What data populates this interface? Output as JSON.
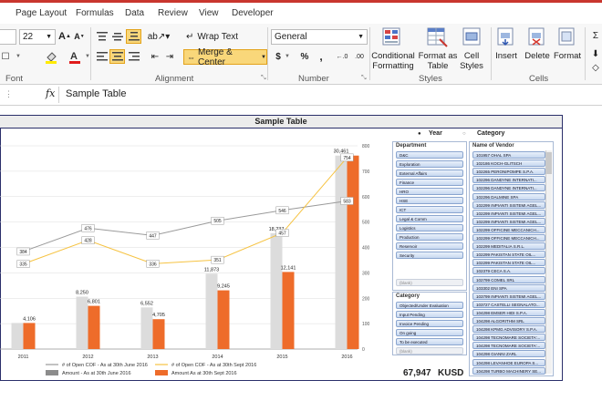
{
  "menu": {
    "items": [
      "Page Layout",
      "Formulas",
      "Data",
      "Review",
      "View",
      "Developer"
    ]
  },
  "ribbon": {
    "font_size": "22",
    "font_group_label": "Font",
    "wrap_text": "Wrap Text",
    "merge_center": "Merge & Center",
    "alignment_label": "Alignment",
    "number_format": "General",
    "number_label": "Number",
    "currency": "$",
    "percent": "%",
    "comma": ",",
    "conditional_formatting": [
      "Conditional",
      "Formatting"
    ],
    "format_as_table": [
      "Format as",
      "Table"
    ],
    "cell_styles": [
      "Cell",
      "Styles"
    ],
    "styles_label": "Styles",
    "insert": "Insert",
    "delete": "Delete",
    "format": "Format",
    "cells_label": "Cells",
    "decimal_inc": "←.0",
    "decimal_dec": ".00"
  },
  "formula": {
    "fx": "fx",
    "value": "Sample Table"
  },
  "dashboard": {
    "title": "Sample Table",
    "radio_year": "Year",
    "radio_category": "Category",
    "total_value": "67,947",
    "total_unit": "KUSD"
  },
  "department_slicer": {
    "header": "Department",
    "items": [
      "D&C",
      "Exploration",
      "External Affairs",
      "Finance",
      "HRO",
      "HSE",
      "ICT",
      "Legal & Comm",
      "Logistics",
      "Production",
      "Reservoir",
      "Security"
    ],
    "dim_items": [
      "(blank)"
    ]
  },
  "category_slicer": {
    "header": "Category",
    "items": [
      "Objected/Under Evaluation",
      "Input Pending",
      "Invoice Pending",
      "On going",
      "To be executed"
    ],
    "dim_items": [
      "(blank)"
    ]
  },
  "vendor_slicer": {
    "header": "Name of Vendor",
    "items": [
      "101957 OHAL SPA",
      "102186 KOCH-GLITSCH",
      "102265 PERONIPOMPE S.P.A.",
      "102296 DANDYNE INTERNATI...",
      "102296 DANDYNE INTERNATI...",
      "102296 DALMINE SPA",
      "102299 INPIANTI SISTEMI AGEL...",
      "102299 INPIANTI SISTEMI AGEL...",
      "102299 INPIANTI SISTEMI AGEL...",
      "102299 OFFICINE MECCANICH...",
      "102299 OFFICINE MECCANICH...",
      "102299 MEDITALIA S.R.L.",
      "102299 PAKISTAN STATE OIL...",
      "102299 PAKISTAN STATE OIL...",
      "102379 CECA S.A.",
      "102799 COMEL SRL",
      "103302 ENI SPA",
      "103799 INPIANTI SISTEMI AGEL...",
      "103727 CASTELLI SEGNALATO...",
      "104298 EMSER HIDI S.P.A.",
      "104298 ALGORITHM SRL",
      "104298 KPMG ADVISORY S.P.A.",
      "104298 TECNOMARE SOCIETA'...",
      "104298 TECNOMARE SOCIETA'...",
      "104298 GIANNI ZARL",
      "104298 LEVANHOE EUROPA S...",
      "104298 TURBO MACHINERY SE..."
    ]
  },
  "chart_data": {
    "type": "bar",
    "categories": [
      "2011",
      "2012",
      "2013",
      "2014",
      "2015",
      "2016"
    ],
    "series": [
      {
        "name": "Amount - As at 30th June 2016",
        "kind": "bar",
        "color": "#8c8c8c",
        "values": [
          4106,
          8250,
          6552,
          11873,
          18237,
          30461
        ]
      },
      {
        "name": "Amount As at 30th Sept 2016",
        "kind": "bar",
        "color": "#ee6c2a",
        "values": [
          4106,
          6801,
          4705,
          9245,
          12141,
          30461
        ]
      },
      {
        "name": "# of Open COF - As at 30th June 2016",
        "kind": "line",
        "color": "#9a9a9a",
        "values": [
          384,
          476,
          447,
          505,
          546,
          583
        ]
      },
      {
        "name": "# of Open COF - As at 30th Sept 2016",
        "kind": "line",
        "color": "#f6c342",
        "values": [
          335,
          428,
          336,
          351,
          457,
          754
        ]
      }
    ],
    "bar_labels": [
      [
        "",
        "8,250",
        "6,552",
        "11,873",
        "18,237",
        "30,461"
      ],
      [
        "4,106",
        "6,801",
        "4,705",
        "9,245",
        "12,141",
        ""
      ]
    ],
    "line_labels": [
      [
        "384",
        "476",
        "447",
        "505",
        "546",
        "583"
      ],
      [
        "335",
        "428",
        "336",
        "351",
        "457",
        "754"
      ]
    ],
    "y2_ticks": [
      "0",
      "100",
      "200",
      "300",
      "400",
      "500",
      "600",
      "700",
      "800"
    ],
    "y2_lim": [
      0,
      800
    ],
    "y_lim": [
      0,
      32000
    ],
    "grid": true,
    "legend_position": "bottom"
  },
  "colors": {
    "accent_red": "#c9362e",
    "bar_orange": "#ee6c2a",
    "bar_grey": "#8c8c8c",
    "line_yellow": "#f6c342",
    "slicer_blue": "#8aa5cf",
    "frame_navy": "#2a2f6a"
  }
}
